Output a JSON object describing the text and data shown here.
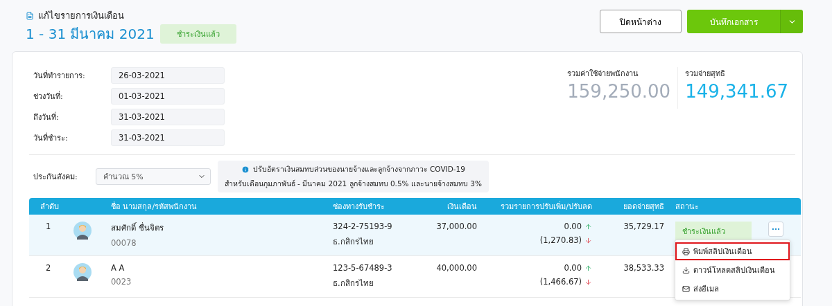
{
  "header": {
    "subtitle": "แก้ไขรายการเงินเดือน",
    "title": "1 - 31 มีนาคม 2021",
    "status": "ชำระเงินแล้ว"
  },
  "actions": {
    "close": "ปิดหน้าต่าง",
    "save": "บันทึกเอกสาร"
  },
  "fields": [
    {
      "label": "วันที่ทำรายการ:",
      "value": "26-03-2021"
    },
    {
      "label": "ช่วงวันที่:",
      "value": "01-03-2021"
    },
    {
      "label": "ถึงวันที่:",
      "value": "31-03-2021"
    },
    {
      "label": "วันที่ชำระ:",
      "value": "31-03-2021"
    }
  ],
  "totals": [
    {
      "label": "รวมค่าใช้จ่ายพนักงาน",
      "value": "159,250.00",
      "kind": "muted"
    },
    {
      "label": "รวมจ่ายสุทธิ",
      "value": "149,341.67",
      "kind": "accent"
    }
  ],
  "social_security": {
    "label": "ประกันสังคม:",
    "value": "คำนวณ 5%"
  },
  "notice": [
    "ปรับอัตราเงินสมทบส่วนของนายจ้างและลูกจ้างจากภาวะ COVID-19",
    "สำหรับเดือนกุมภาพันธ์ - มีนาคม 2021 ลูกจ้างสมทบ 0.5% และนายจ้างสมทบ 3%"
  ],
  "table": {
    "columns": [
      "ลำดับ",
      "ชื่อ นามสกุล/รหัสพนักงาน",
      "ช่องทางรับชำระ",
      "เงินเดือน",
      "รวมรายการปรับเพิ่ม/ปรับลด",
      "ยอดจ่ายสุทธิ",
      "สถานะ"
    ],
    "rows": [
      {
        "selected": true,
        "index": "1",
        "name": "สมศักดิ์ ชื่นจิตร",
        "code": "00078",
        "account": "324-2-75193-9",
        "bank": "ธ.กสิกรไทย",
        "salary": "37,000.00",
        "adjustments": [
          {
            "kind": "increase",
            "value": "0.00"
          },
          {
            "kind": "decrease",
            "value": "(1,270.83)"
          }
        ],
        "net": "35,729.17",
        "status": "ชำระเงินแล้ว"
      },
      {
        "selected": false,
        "index": "2",
        "name": "A A",
        "code": "0023",
        "account": "123-5-67489-3",
        "bank": "ธ.กสิกรไทย",
        "salary": "40,000.00",
        "adjustments": [
          {
            "kind": "increase",
            "value": "0.00"
          },
          {
            "kind": "decrease",
            "value": "(1,466.67)"
          }
        ],
        "net": "38,533.33"
      }
    ]
  },
  "row_menu": {
    "items": [
      {
        "kind": "print",
        "label": "พิมพ์สลิปเงินเดือน",
        "highlighted": true
      },
      {
        "kind": "download",
        "label": "ดาวน์โหลดสลิปเงินเดือน",
        "highlighted": false
      },
      {
        "kind": "email",
        "label": "ส่งอีเมล",
        "highlighted": false
      }
    ]
  }
}
